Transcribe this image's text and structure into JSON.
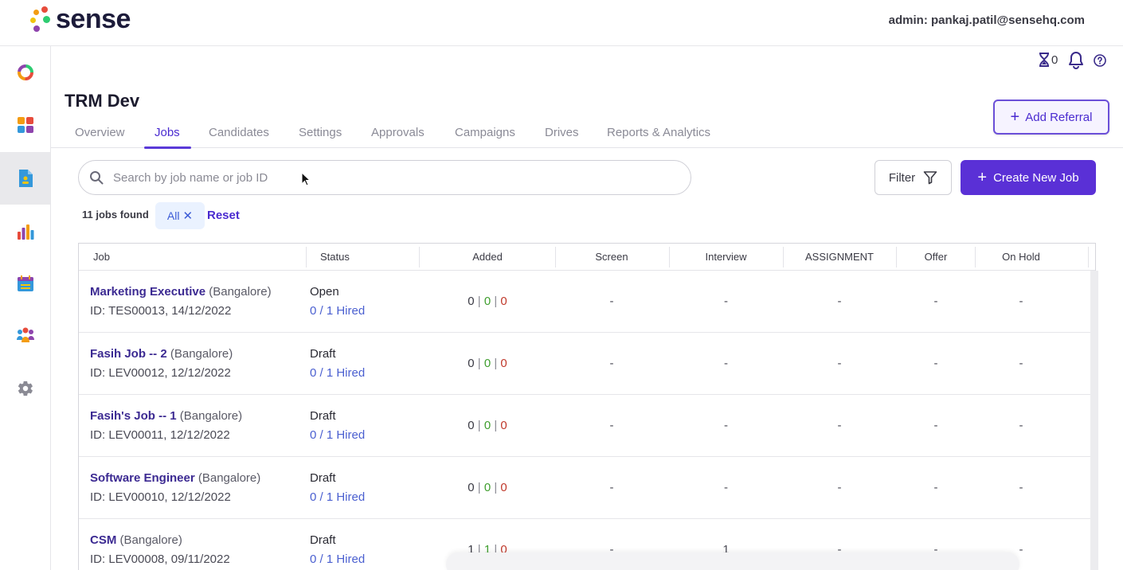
{
  "app": {
    "logo_text": "sense",
    "admin_label": "admin: pankaj.patil@sensehq.com"
  },
  "utility": {
    "hourglass_count": "0"
  },
  "page": {
    "title": "TRM Dev"
  },
  "tabs": [
    {
      "label": "Overview"
    },
    {
      "label": "Jobs"
    },
    {
      "label": "Candidates"
    },
    {
      "label": "Settings"
    },
    {
      "label": "Approvals"
    },
    {
      "label": "Campaigns"
    },
    {
      "label": "Drives"
    },
    {
      "label": "Reports & Analytics"
    }
  ],
  "actions": {
    "add_referral": "Add Referral",
    "filter": "Filter",
    "create_job": "Create New Job"
  },
  "search": {
    "placeholder": "Search by job name or job ID",
    "value": ""
  },
  "results": {
    "found": "11 jobs found",
    "chip": "All",
    "reset": "Reset"
  },
  "table": {
    "headers": [
      "Job",
      "Status",
      "Added",
      "Screen",
      "Interview",
      "ASSIGNMENT",
      "Offer",
      "On Hold"
    ],
    "rows": [
      {
        "name": "Marketing Executive",
        "location": "(Bangalore)",
        "id": "ID: TES00013, 14/12/2022",
        "status": "Open",
        "hired": "0 / 1 Hired",
        "added_a": "0",
        "added_b": "0",
        "added_c": "0",
        "screen": "-",
        "interview": "-",
        "assignment": "-",
        "offer": "-",
        "onhold": "-"
      },
      {
        "name": "Fasih Job -- 2",
        "location": "(Bangalore)",
        "id": "ID: LEV00012, 12/12/2022",
        "status": "Draft",
        "hired": "0 / 1 Hired",
        "added_a": "0",
        "added_b": "0",
        "added_c": "0",
        "screen": "-",
        "interview": "-",
        "assignment": "-",
        "offer": "-",
        "onhold": "-"
      },
      {
        "name": "Fasih's Job -- 1",
        "location": "(Bangalore)",
        "id": "ID: LEV00011, 12/12/2022",
        "status": "Draft",
        "hired": "0 / 1 Hired",
        "added_a": "0",
        "added_b": "0",
        "added_c": "0",
        "screen": "-",
        "interview": "-",
        "assignment": "-",
        "offer": "-",
        "onhold": "-"
      },
      {
        "name": "Software Engineer",
        "location": "(Bangalore)",
        "id": "ID: LEV00010, 12/12/2022",
        "status": "Draft",
        "hired": "0 / 1 Hired",
        "added_a": "0",
        "added_b": "0",
        "added_c": "0",
        "screen": "-",
        "interview": "-",
        "assignment": "-",
        "offer": "-",
        "onhold": "-"
      },
      {
        "name": "CSM",
        "location": "(Bangalore)",
        "id": "ID: LEV00008, 09/11/2022",
        "status": "Draft",
        "hired": "0 / 1 Hired",
        "added_a": "1",
        "added_b": "1",
        "added_c": "0",
        "screen": "-",
        "interview": "1",
        "assignment": "-",
        "offer": "-",
        "onhold": "-"
      }
    ]
  },
  "colors": {
    "brand": "#5a30d6",
    "link": "#3c2a92",
    "accent_blue": "#4a5fd0",
    "green": "#3f9e2e",
    "red": "#c0392b"
  }
}
